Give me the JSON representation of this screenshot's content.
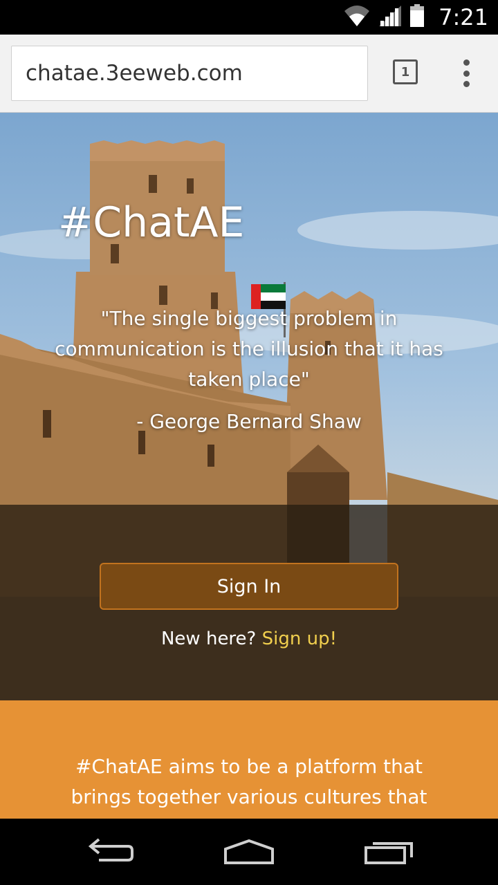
{
  "status_bar": {
    "time": "7:21",
    "icons": [
      "wifi-icon",
      "cell-signal-icon",
      "battery-icon"
    ]
  },
  "browser": {
    "url": "chatae.3eeweb.com",
    "tab_count": "1",
    "menu_icon": "overflow-menu-icon"
  },
  "hero": {
    "title": "#ChatAE",
    "quote": "\"The single biggest problem in communication is the illusion that it has taken place\"",
    "author": "- George Bernard Shaw",
    "signin_label": "Sign In",
    "signup_prompt": "New here?",
    "signup_link": "Sign up!"
  },
  "about": {
    "text": "#ChatAE aims to be a platform that brings together various cultures that"
  },
  "nav_bar": {
    "buttons": [
      "back-icon",
      "home-icon",
      "recent-apps-icon"
    ]
  },
  "colors": {
    "accent_orange": "#e69235",
    "button_brown": "#7a4a14",
    "link_yellow": "#f1cf4e"
  }
}
